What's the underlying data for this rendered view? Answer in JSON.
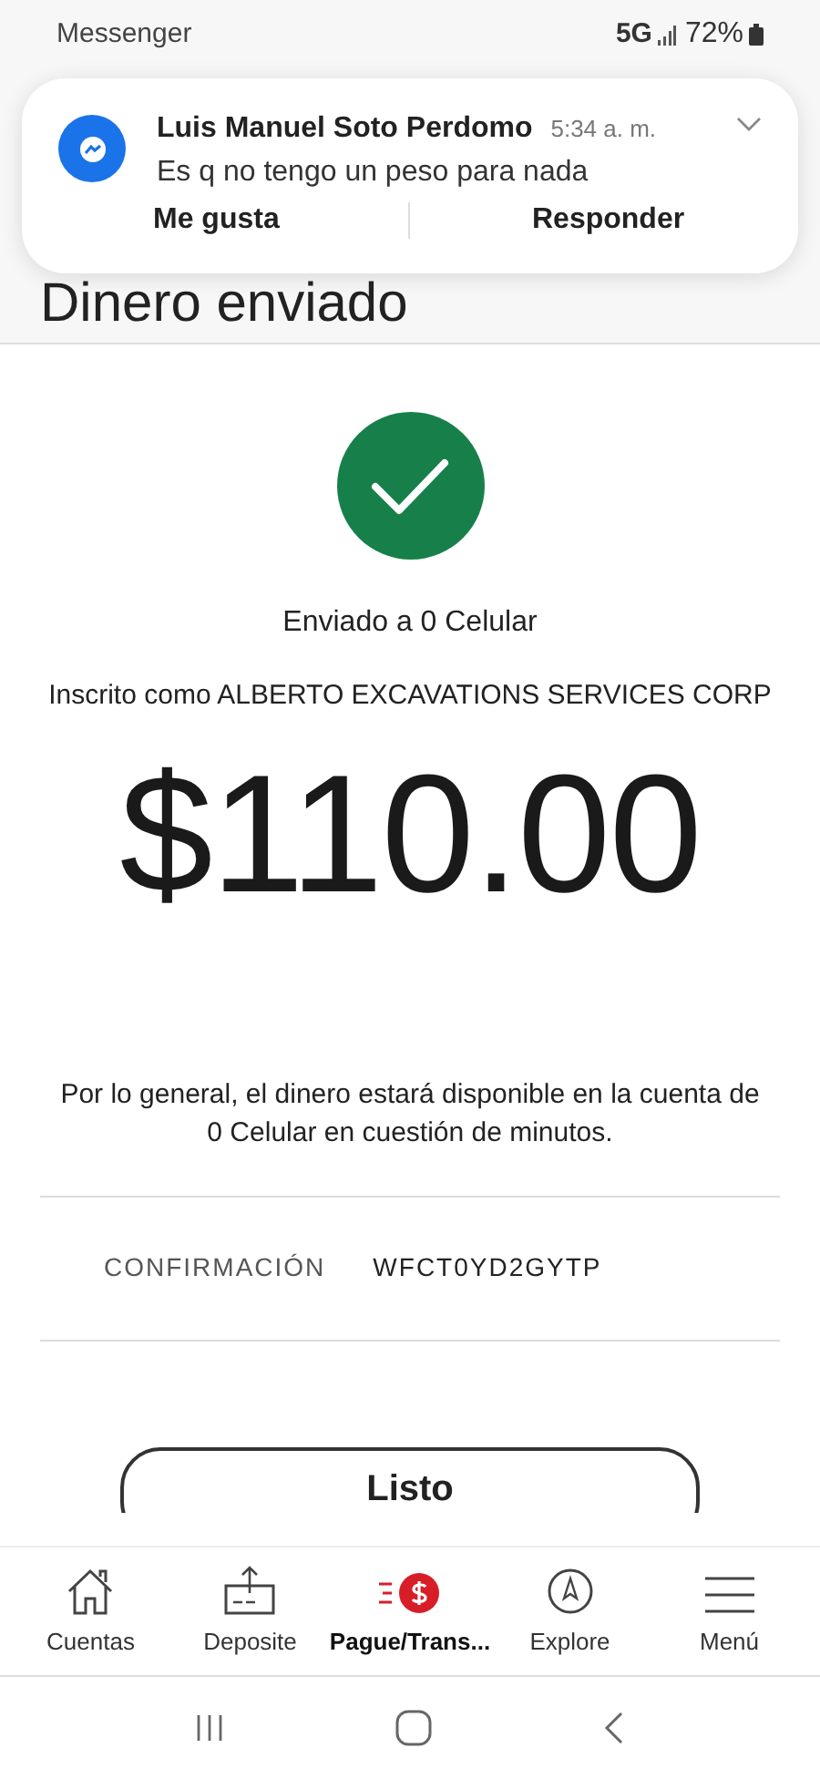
{
  "status_bar": {
    "app": "Messenger",
    "network": "5G",
    "battery": "72%"
  },
  "notification": {
    "sender": "Luis Manuel Soto Perdomo",
    "time": "5:34 a. m.",
    "message": "Es q no tengo un peso para nada",
    "actions": [
      "Me gusta",
      "Responder"
    ]
  },
  "page": {
    "title": "Dinero enviado",
    "sent_to": "Enviado a 0 Celular",
    "enrolled_as": "Inscrito como ALBERTO EXCAVATIONS SERVICES CORP",
    "amount": "$110.00",
    "note": "Por lo general, el dinero estará disponible en la cuenta de 0 Celular en cuestión de minutos.",
    "confirmation_label": "CONFIRMACIÓN",
    "confirmation_code": "WFCT0YD2GYTP",
    "done_button": "Listo"
  },
  "bottom_nav": [
    {
      "kind": "home",
      "label": "Cuentas",
      "selected": false
    },
    {
      "kind": "deposit",
      "label": "Deposite",
      "selected": false
    },
    {
      "kind": "pay",
      "label": "Pague/Trans...",
      "selected": true
    },
    {
      "kind": "explore",
      "label": "Explore",
      "selected": false
    },
    {
      "kind": "menu",
      "label": "Menú",
      "selected": false
    }
  ]
}
